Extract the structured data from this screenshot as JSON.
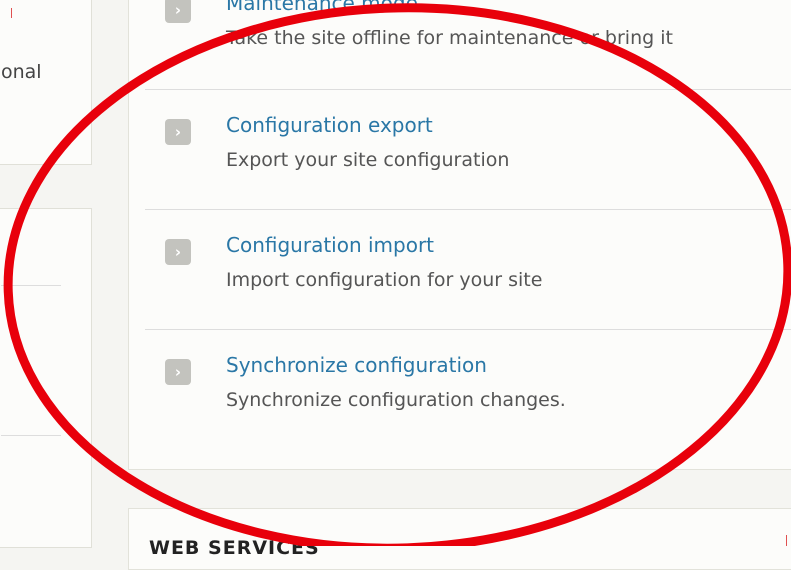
{
  "left_column": {
    "partial_text": "onal"
  },
  "main": {
    "items": [
      {
        "title": "Maintenance mode",
        "description": "Take the site offline for maintenance or bring it",
        "icon": "chevron-right-icon"
      },
      {
        "title": "Configuration export",
        "description": "Export your site configuration",
        "icon": "chevron-right-icon"
      },
      {
        "title": "Configuration import",
        "description": "Import configuration for your site",
        "icon": "chevron-right-icon"
      },
      {
        "title": "Synchronize configuration",
        "description": "Synchronize configuration changes.",
        "icon": "chevron-right-icon"
      }
    ]
  },
  "web_services": {
    "heading": "WEB SERVICES"
  },
  "colors": {
    "link": "#2a77a6",
    "icon_bg": "#c3c3be",
    "annotation_stroke": "#e8000b"
  }
}
